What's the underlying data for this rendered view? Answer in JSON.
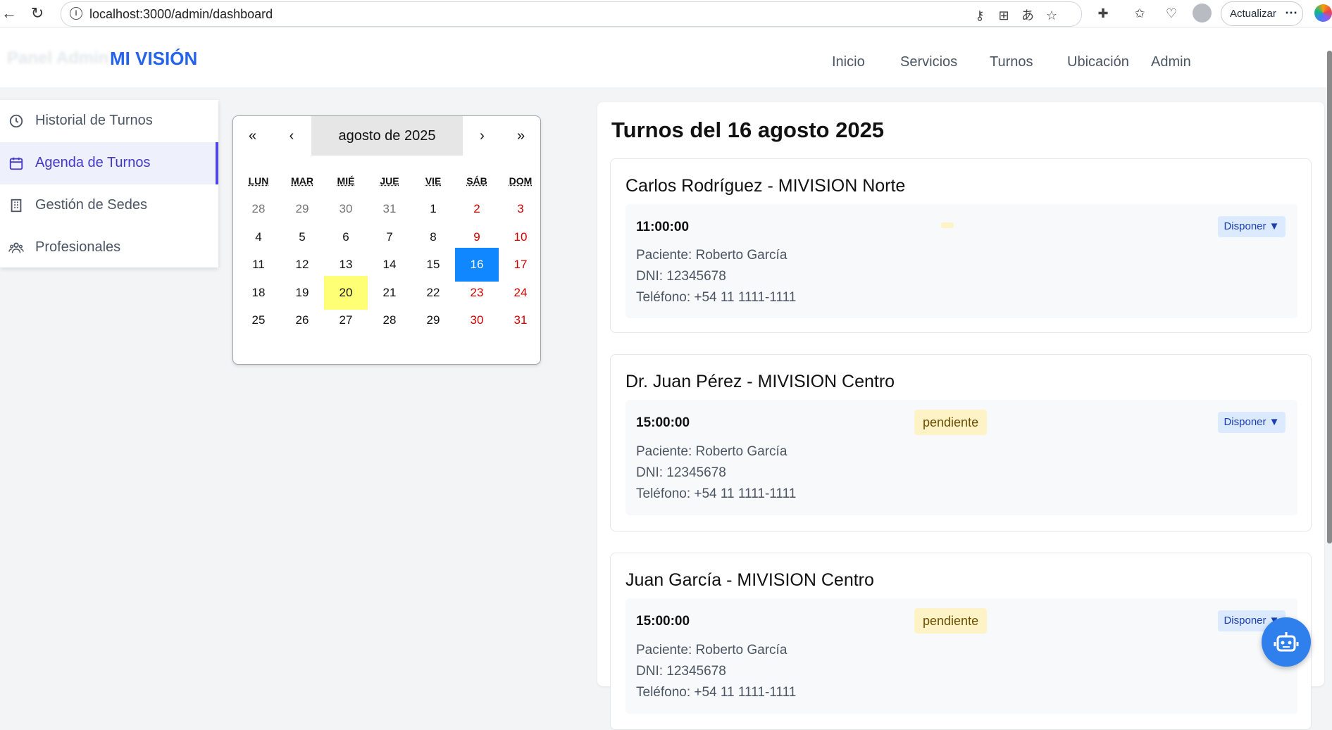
{
  "browser": {
    "url": "localhost:3000/admin/dashboard",
    "update_label": "Actualizar",
    "more_label": "⋯"
  },
  "header": {
    "ghost_title": "Panel Admin",
    "brand": "MI VISIÓN",
    "nav": [
      "Inicio",
      "Servicios",
      "Turnos",
      "Ubicación",
      "Admin"
    ]
  },
  "sidebar": {
    "items": [
      {
        "label": "Historial de Turnos",
        "icon": "clock-icon"
      },
      {
        "label": "Agenda de Turnos",
        "icon": "calendar-icon",
        "active": true
      },
      {
        "label": "Gestión de Sedes",
        "icon": "building-icon"
      },
      {
        "label": "Profesionales",
        "icon": "users-icon"
      }
    ]
  },
  "calendar": {
    "prev2": "«",
    "prev": "‹",
    "month": "agosto de 2025",
    "next": "›",
    "next2": "»",
    "weekdays": [
      "LUN",
      "MAR",
      "MIÉ",
      "JUE",
      "VIE",
      "SÁB",
      "DOM"
    ],
    "weeks": [
      [
        "28",
        "29",
        "30",
        "31",
        "1",
        "2",
        "3"
      ],
      [
        "4",
        "5",
        "6",
        "7",
        "8",
        "9",
        "10"
      ],
      [
        "11",
        "12",
        "13",
        "14",
        "15",
        "16",
        "17"
      ],
      [
        "18",
        "19",
        "20",
        "21",
        "22",
        "23",
        "24"
      ],
      [
        "25",
        "26",
        "27",
        "28",
        "29",
        "30",
        "31"
      ]
    ],
    "selected_day": "16",
    "today_day": "20"
  },
  "main": {
    "title": "Turnos del 16 agosto 2025",
    "appointments": [
      {
        "title": "Carlos Rodríguez - MIVISION Norte",
        "time": "11:00:00",
        "status": "",
        "action": "Disponer ▼",
        "patient": "Paciente: Roberto García",
        "dni": "DNI: 12345678",
        "phone": "Teléfono: +54 11 1111-1111"
      },
      {
        "title": "Dr. Juan Pérez - MIVISION Centro",
        "time": "15:00:00",
        "status": "pendiente",
        "action": "Disponer ▼",
        "patient": "Paciente: Roberto García",
        "dni": "DNI: 12345678",
        "phone": "Teléfono: +54 11 1111-1111"
      },
      {
        "title": "Juan García - MIVISION Centro",
        "time": "15:00:00",
        "status": "pendiente",
        "action": "Disponer ▼",
        "patient": "Paciente: Roberto García",
        "dni": "DNI: 12345678",
        "phone": "Teléfono: +54 11 1111-1111"
      }
    ]
  },
  "colors": {
    "brand": "#2563eb",
    "active_accent": "#4f46e5",
    "selected_day": "#1087ff",
    "today_day": "#ffff76",
    "weekend": "#d10000",
    "badge_pending": "#fef3c7"
  }
}
